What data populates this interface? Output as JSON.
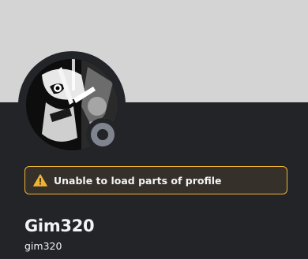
{
  "profile": {
    "display_name": "Gim320",
    "username": "gim320",
    "status": "offline"
  },
  "warning": {
    "message": "Unable to load parts of profile",
    "icon": "warning-icon"
  },
  "colors": {
    "banner": "#d4d4d4",
    "background": "#232428",
    "warning_border": "#f0b232",
    "status_offline": "#80848e"
  }
}
